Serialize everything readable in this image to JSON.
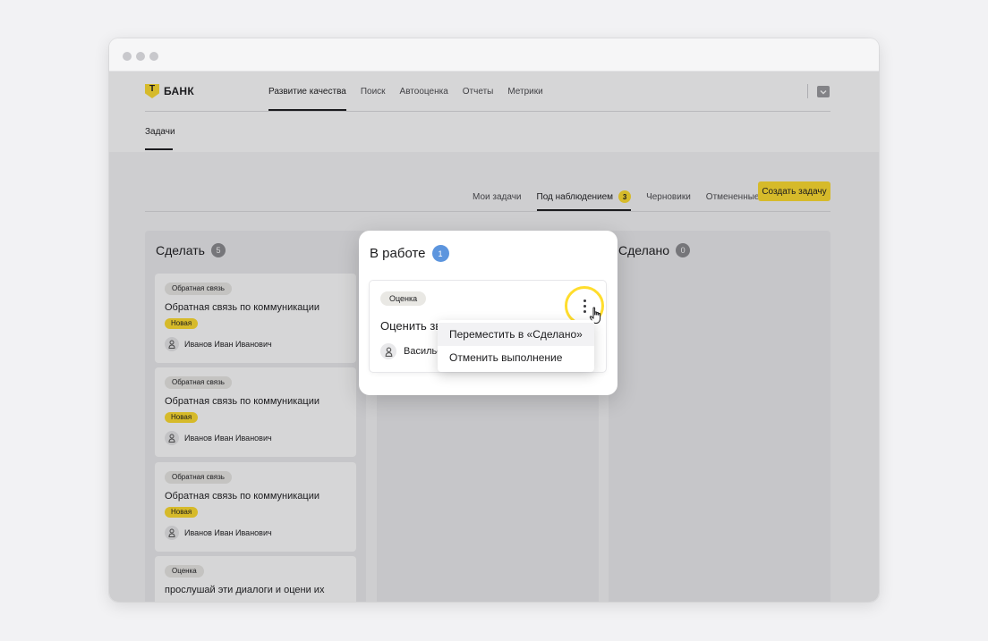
{
  "app": {
    "logo_text": "БАНК",
    "logo_letter": "Т",
    "nav": [
      "Развитие качества",
      "Поиск",
      "Автооценка",
      "Отчеты",
      "Метрики"
    ],
    "active_nav": "Развитие качества",
    "subtab": "Задачи"
  },
  "tabs": {
    "items": [
      {
        "label": "Мои задачи",
        "count": null,
        "active": false
      },
      {
        "label": "Под наблюдением",
        "count": "3",
        "active": true
      },
      {
        "label": "Черновики",
        "count": null,
        "active": false
      },
      {
        "label": "Отмененные",
        "count": null,
        "active": false
      }
    ],
    "create_button": "Создать задачу"
  },
  "columns": {
    "todo": {
      "title": "Сделать",
      "count": "5",
      "cards": [
        {
          "category": "Обратная связь",
          "title": "Обратная связь по коммуникации",
          "status": "Новая",
          "assignee": "Иванов Иван Иванович"
        },
        {
          "category": "Обратная связь",
          "title": "Обратная связь по коммуникации",
          "status": "Новая",
          "assignee": "Иванов Иван Иванович"
        },
        {
          "category": "Обратная связь",
          "title": "Обратная связь по коммуникации",
          "status": "Новая",
          "assignee": "Иванов Иван Иванович"
        },
        {
          "category": "Оценка",
          "title": "прослушай эти диалоги и оцени их"
        }
      ]
    },
    "in_progress": {
      "title": "В работе",
      "count": "1",
      "card": {
        "category": "Оценка",
        "title": "Оценить зв",
        "assignee": "Васильев"
      }
    },
    "done": {
      "title": "Сделано",
      "count": "0"
    }
  },
  "context_menu": {
    "items": [
      "Переместить в «Сделано»",
      "Отменить выполнение"
    ]
  },
  "colors": {
    "accent": "#ffdd2d",
    "in_progress_count": "#5c95de"
  }
}
